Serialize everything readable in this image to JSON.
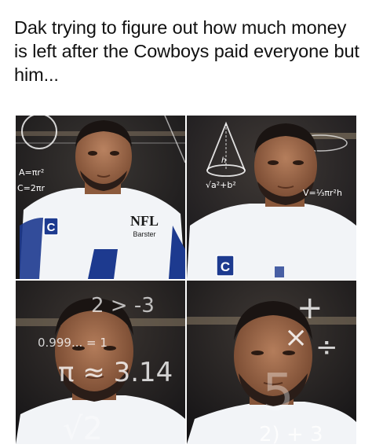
{
  "caption": "Dak trying to figure out how much money is left after the Cowboys paid everyone but him...",
  "panels": [
    {
      "jersey_letter": "C",
      "logo_text": "NFL",
      "logo_sub": "Barster",
      "math": [
        "A=πr²",
        "C=2πr"
      ]
    },
    {
      "jersey_letter": "C",
      "math": [
        "h",
        "√a²+b²",
        "V=⅓πr²h"
      ]
    },
    {
      "math": [
        "2 > -3",
        "0.999... = 1",
        "π ≈ 3.14",
        "√2"
      ]
    },
    {
      "math": [
        "+",
        "×",
        "÷",
        "5",
        "2) + 3"
      ]
    }
  ],
  "colors": {
    "jersey": "#f2f4f7",
    "jersey_blue": "#1d3a8f",
    "skin": "#a9714d",
    "skin_dark": "#7a4a30",
    "hair": "#1a1412",
    "stadium": "#1b1a1d"
  }
}
